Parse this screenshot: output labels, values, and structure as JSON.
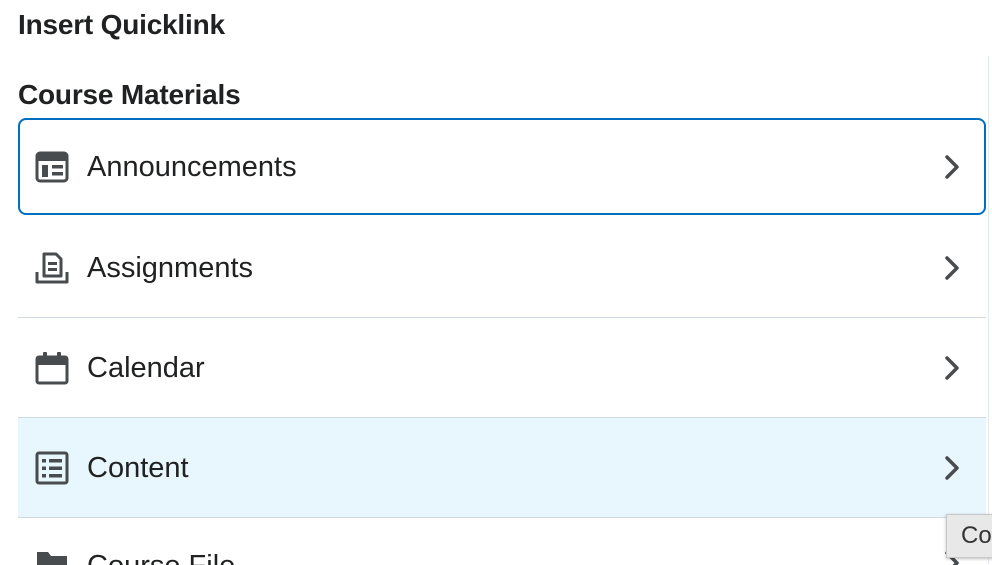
{
  "dialog": {
    "title": "Insert Quicklink"
  },
  "section": {
    "heading": "Course Materials"
  },
  "items": [
    {
      "label": "Announcements",
      "icon": "announcements-icon",
      "state": "focused"
    },
    {
      "label": "Assignments",
      "icon": "assignments-icon",
      "state": "normal"
    },
    {
      "label": "Calendar",
      "icon": "calendar-icon",
      "state": "normal"
    },
    {
      "label": "Content",
      "icon": "content-list-icon",
      "state": "hovered"
    },
    {
      "label": "Course File",
      "icon": "folder-icon",
      "state": "partially-visible"
    }
  ],
  "tooltip": {
    "text": "Co"
  },
  "colors": {
    "focus_border": "#006fbf",
    "hover_background": "#e8f6fd",
    "divider": "#d3d9e3",
    "icon": "#494c4e",
    "text": "#202122"
  }
}
